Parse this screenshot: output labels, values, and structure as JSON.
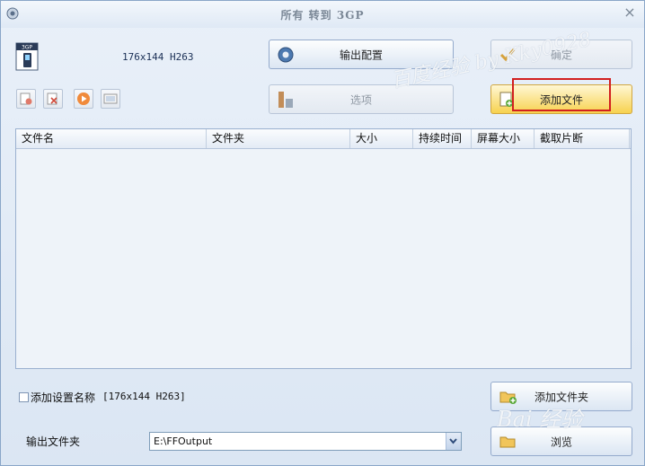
{
  "window": {
    "title": "所有 转到 3GP",
    "close_glyph": "×"
  },
  "format": {
    "icon_label": "3GP",
    "description": "176x144 H263"
  },
  "buttons": {
    "output_config": "输出配置",
    "confirm": "确定",
    "options": "选项",
    "add_file": "添加文件",
    "add_folder": "添加文件夹",
    "browse": "浏览"
  },
  "toolbar": {
    "items": [
      "remove-icon",
      "clear-icon",
      "play-icon",
      "preview-icon"
    ]
  },
  "table": {
    "columns": [
      "文件名",
      "文件夹",
      "大小",
      "持续时间",
      "屏幕大小",
      "截取片断"
    ],
    "rows": []
  },
  "settings": {
    "add_name_label": "添加设置名称",
    "add_name_value": "[176x144 H263]",
    "add_name_checked": false
  },
  "output": {
    "label": "输出文件夹",
    "path": "E:\\FFOutput"
  },
  "watermarks": {
    "top": "百度经验 by Kky0928",
    "bottom": "Bai 经验"
  },
  "colors": {
    "highlight_border": "#d21f1f",
    "add_button": "#f7d24f",
    "background": "#dfe9f5"
  }
}
